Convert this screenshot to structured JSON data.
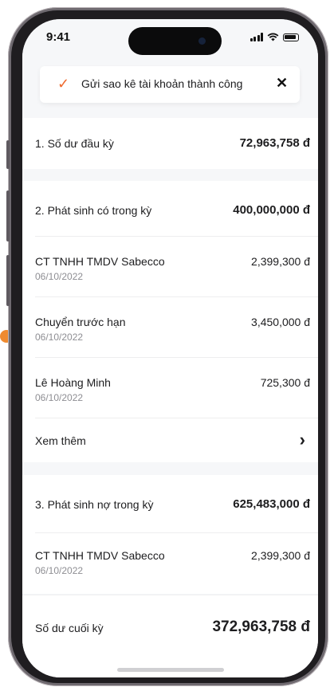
{
  "status_bar": {
    "time": "9:41"
  },
  "toast": {
    "message": "Gửi sao kê tài khoản thành công",
    "check_icon": "✓",
    "close_icon": "✕"
  },
  "opening_balance": {
    "label": "1. Số dư đầu kỳ",
    "value": "72,963,758 đ"
  },
  "credits": {
    "label": "2. Phát sinh có trong kỳ",
    "total": "400,000,000 đ",
    "items": [
      {
        "name": "CT TNHH TMDV Sabecco",
        "date": "06/10/2022",
        "amount": "2,399,300 đ"
      },
      {
        "name": "Chuyển trước hạn",
        "date": "06/10/2022",
        "amount": "3,450,000 đ"
      },
      {
        "name": "Lê Hoàng Minh",
        "date": "06/10/2022",
        "amount": "725,300 đ"
      }
    ],
    "see_more": "Xem thêm",
    "chevron_icon": "›"
  },
  "debits": {
    "label": "3. Phát sinh nợ trong kỳ",
    "total": "625,483,000 đ",
    "items": [
      {
        "name": "CT TNHH TMDV Sabecco",
        "date": "06/10/2022",
        "amount": "2,399,300 đ"
      }
    ]
  },
  "closing_balance": {
    "label": "Số dư cuối kỳ",
    "value": "372,963,758 đ"
  },
  "colors": {
    "accent": "#ef6a2e",
    "background": "#f6f7f9",
    "card": "#ffffff",
    "muted_text": "#8e8e93"
  }
}
